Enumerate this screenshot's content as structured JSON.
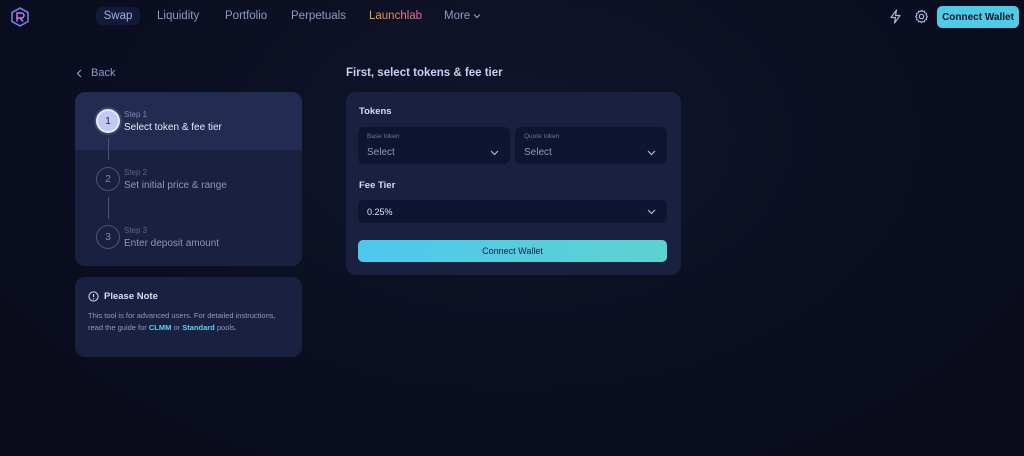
{
  "nav": {
    "items": [
      {
        "label": "Swap"
      },
      {
        "label": "Liquidity"
      },
      {
        "label": "Portfolio"
      },
      {
        "label": "Perpetuals"
      },
      {
        "label": "Launchlab"
      },
      {
        "label": "More"
      }
    ],
    "connect_label": "Connect Wallet"
  },
  "back_label": "Back",
  "steps": [
    {
      "kicker": "Step 1",
      "title": "Select token & fee tier",
      "number": "1",
      "active": true
    },
    {
      "kicker": "Step 2",
      "title": "Set initial price & range",
      "number": "2",
      "active": false
    },
    {
      "kicker": "Step 3",
      "title": "Enter deposit amount",
      "number": "3",
      "active": false
    }
  ],
  "note": {
    "title": "Please Note",
    "text_before": "This tool is for advanced users. For detailed instructions, read the guide for ",
    "link1": "CLMM",
    "text_mid": " or ",
    "link2": "Standard",
    "text_after": " pools."
  },
  "form": {
    "title": "First, select tokens & fee tier",
    "tokens_label": "Tokens",
    "base_caption": "Base token",
    "base_value": "Select",
    "quote_caption": "Quote token",
    "quote_value": "Select",
    "fee_label": "Fee Tier",
    "fee_value": "0.25%",
    "connect_label": "Connect Wallet"
  },
  "colors": {
    "accent": "#4fcbe6",
    "card": "#1a2140",
    "background": "#0b0e20",
    "launchlab_gradient": [
      "#f0a73a",
      "#f25fa6"
    ]
  },
  "icons": [
    "logo-icon",
    "chevron-down-icon",
    "bolt-icon",
    "gear-icon",
    "chevron-left-icon",
    "info-icon"
  ]
}
